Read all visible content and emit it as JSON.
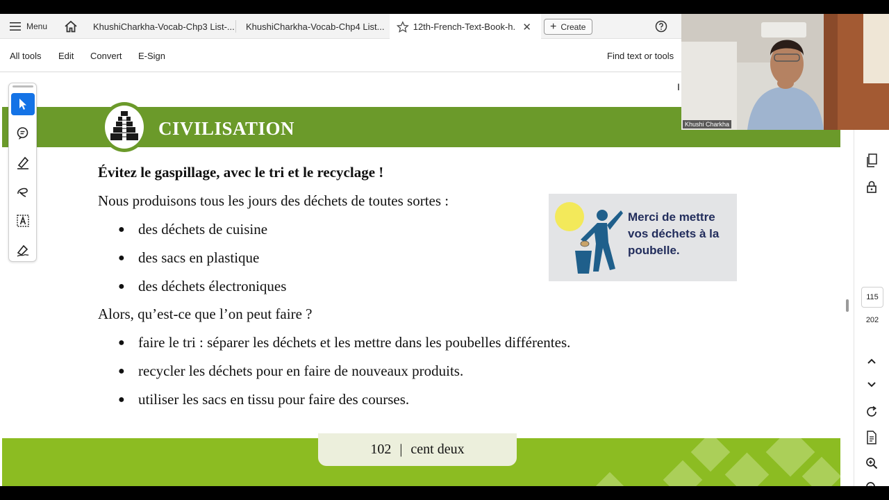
{
  "tabbar": {
    "menu_label": "Menu",
    "tabs": [
      {
        "label": "KhushiCharkha-Vocab-Chp3 List-..."
      },
      {
        "label": "KhushiCharkha-Vocab-Chp4 List..."
      },
      {
        "label": "12th-French-Text-Book-h..."
      }
    ],
    "create_label": "Create",
    "help_icon": "help-circle-icon"
  },
  "toolbar": {
    "items": [
      "All tools",
      "Edit",
      "Convert",
      "E-Sign"
    ],
    "find_label": "Find text or tools"
  },
  "left_tools": [
    "select-pointer-icon",
    "add-comment-icon",
    "highlight-pen-icon",
    "draw-freeform-icon",
    "text-box-icon",
    "sign-pen-icon"
  ],
  "right_panel": {
    "current_page": "115",
    "total_pages": "202"
  },
  "document": {
    "section_title": "CIVILISATION",
    "heading": "Évitez le gaspillage, avec le tri et le recyclage !",
    "intro": "Nous produisons tous les jours des déchets de toutes sortes :",
    "waste_items": [
      "des déchets de cuisine",
      "des sacs en plastique",
      "des déchets électroniques"
    ],
    "question": "Alors, qu’est-ce que l’on peut faire ?",
    "actions": [
      "faire le tri : séparer les déchets et les mettre dans les poubelles différentes.",
      "recycler les déchets pour en faire de nouveaux produits.",
      "utiliser les sacs en tissu pour faire des courses."
    ],
    "poster_text": "Merci de mettre vos déchets à la poubelle.",
    "page_number": "102",
    "page_words": "cent deux",
    "colors": {
      "green_bar": "#6b9a2a",
      "footer_green": "#8cbc22",
      "poster_blue": "#1f5f8b",
      "sun_yellow": "#f3e95a"
    }
  },
  "webcam": {
    "participant_name": "Khushi Charkha"
  }
}
